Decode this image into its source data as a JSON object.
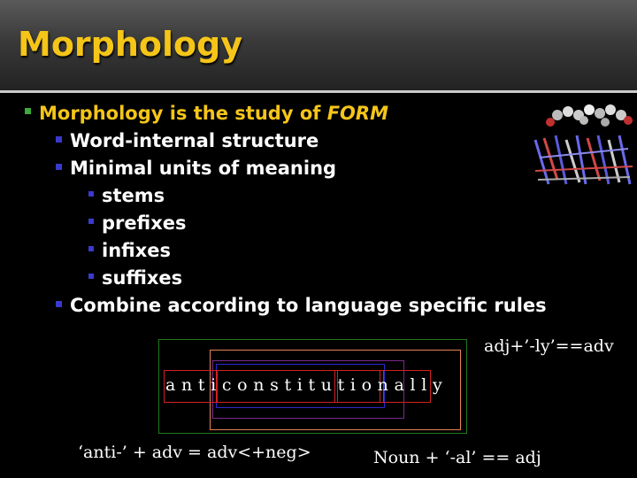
{
  "slide": {
    "title": "Morphology",
    "bullet1_prefix": "Morphology is the study of ",
    "bullet1_emph": "FORM",
    "sub_bullets": [
      "Word-internal  structure",
      "Minimal units of meaning"
    ],
    "sub_sub_bullets": [
      "stems",
      "prefixes",
      "infixes",
      "suffixes"
    ],
    "last_sub_bullet": "Combine according to language specific rules"
  },
  "diagram": {
    "word": "a n t i c o n s t i t u t i o n a l l y",
    "label_top_right": "adj+’-ly’==adv",
    "label_bottom_left": "‘anti-’ + adv = adv<+neg>",
    "label_bottom_right": "Noun + ‘-al’ == adj"
  },
  "colors": {
    "title": "#f5c518",
    "bullet_l1": "#3caa3c",
    "bullet_l2": "#3a3acc",
    "green_box": "#1f7a1f",
    "orange_box": "#e8835a",
    "red_box": "#d42020",
    "purple_box": "#7a2a8a",
    "blue_box": "#2a2ad0"
  }
}
